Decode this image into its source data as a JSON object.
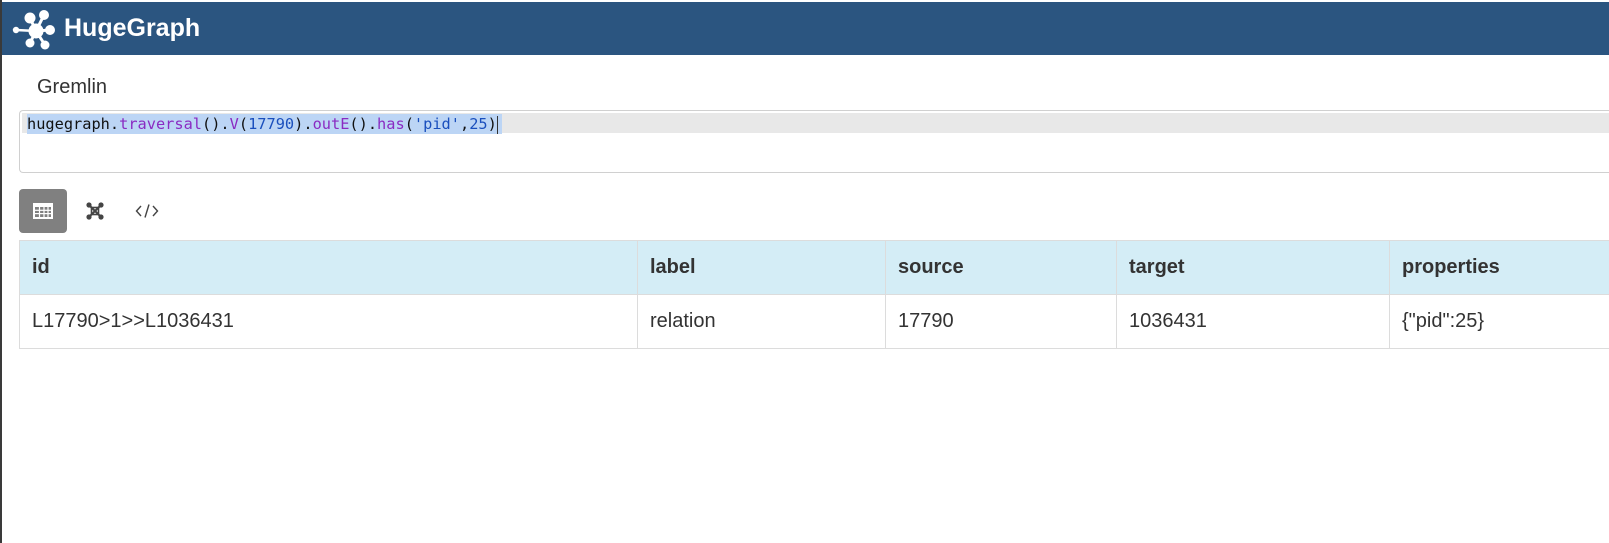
{
  "app": {
    "brand": "HugeGraph",
    "logo_icon": "hugegraph-logo-icon",
    "colors": {
      "header_bg": "#2b5580",
      "table_header_bg": "#d4edf6",
      "active_tab_bg": "#808080"
    }
  },
  "query": {
    "section_label": "Gremlin",
    "tokens": {
      "t1": "hugegraph",
      "t2": ".",
      "t3": "traversal",
      "t4": "().",
      "t5": "V",
      "t6": "(",
      "t7": "17790",
      "t8": ").",
      "t9": "outE",
      "t10": "().",
      "t11": "has",
      "t12": "(",
      "t13": "'pid'",
      "t14": ",",
      "t15": "25",
      "t16": ")"
    }
  },
  "view_tabs": [
    {
      "name": "table",
      "icon": "table-icon",
      "active": true
    },
    {
      "name": "graph",
      "icon": "graph-icon",
      "active": false
    },
    {
      "name": "json",
      "icon": "code-icon",
      "active": false
    }
  ],
  "results": {
    "columns": [
      "id",
      "label",
      "source",
      "target",
      "properties"
    ],
    "rows": [
      [
        "L17790>1>>L1036431",
        "relation",
        "17790",
        "1036431",
        "{\"pid\":25}"
      ]
    ]
  }
}
